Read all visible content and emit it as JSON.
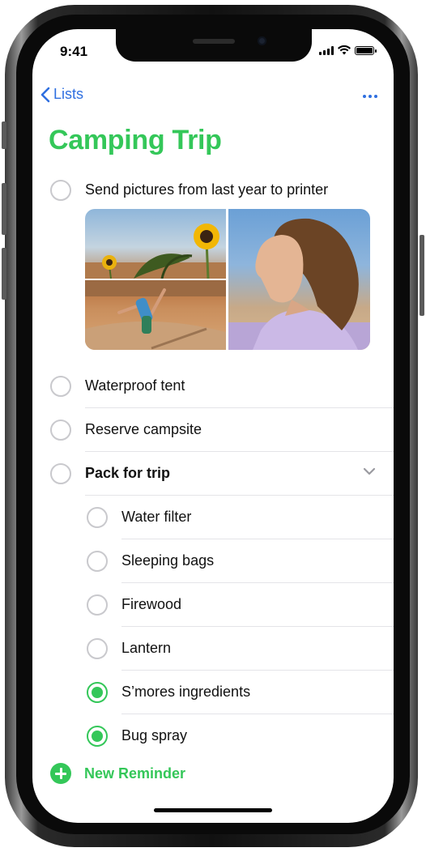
{
  "status_bar": {
    "time": "9:41"
  },
  "nav": {
    "back_label": "Lists",
    "more_icon": "ellipsis-icon"
  },
  "list": {
    "title": "Camping Trip",
    "accent_color": "#34c759"
  },
  "reminders": [
    {
      "label": "Send pictures from last year to printer",
      "done": false,
      "has_attachments": true
    },
    {
      "label": "Waterproof tent",
      "done": false
    },
    {
      "label": "Reserve campsite",
      "done": false
    },
    {
      "label": "Pack for trip",
      "done": false,
      "expanded": true,
      "subtasks": [
        {
          "label": "Water filter",
          "done": false
        },
        {
          "label": "Sleeping bags",
          "done": false
        },
        {
          "label": "Firewood",
          "done": false
        },
        {
          "label": "Lantern",
          "done": false
        },
        {
          "label": "S’mores ingredients",
          "done": true
        },
        {
          "label": "Bug spray",
          "done": true
        }
      ]
    }
  ],
  "footer": {
    "new_reminder_label": "New Reminder"
  }
}
